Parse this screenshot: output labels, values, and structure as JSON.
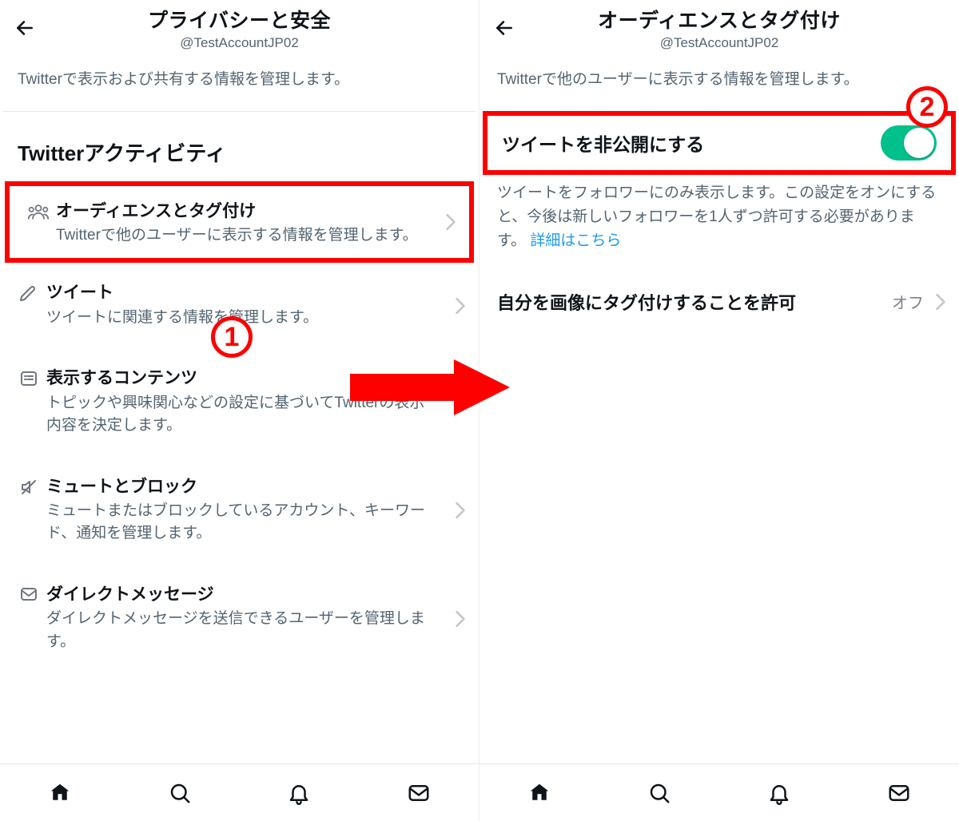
{
  "left": {
    "title": "プライバシーと安全",
    "handle": "@TestAccountJP02",
    "subhead": "Twitterで表示および共有する情報を管理します。",
    "section_label": "Twitterアクティビティ",
    "items": [
      {
        "title": "オーディエンスとタグ付け",
        "desc": "Twitterで他のユーザーに表示する情報を管理します。"
      },
      {
        "title": "ツイート",
        "desc": "ツイートに関連する情報を管理します。"
      },
      {
        "title": "表示するコンテンツ",
        "desc": "トピックや興味関心などの設定に基づいてTwitterの表示内容を決定します。"
      },
      {
        "title": "ミュートとブロック",
        "desc": "ミュートまたはブロックしているアカウント、キーワード、通知を管理します。"
      },
      {
        "title": "ダイレクトメッセージ",
        "desc": "ダイレクトメッセージを送信できるユーザーを管理します。"
      }
    ]
  },
  "right": {
    "title": "オーディエンスとタグ付け",
    "handle": "@TestAccountJP02",
    "subhead": "Twitterで他のユーザーに表示する情報を管理します。",
    "protect_label": "ツイートを非公開にする",
    "protect_desc": "ツイートをフォロワーにのみ表示します。この設定をオンにすると、今後は新しいフォロワーを1人ずつ許可する必要があります。 ",
    "learn_more": "詳細はこちら",
    "tagging_label": "自分を画像にタグ付けすることを許可",
    "tagging_value": "オフ"
  },
  "annotations": {
    "one": "1",
    "two": "2"
  },
  "colors": {
    "accent": "#ff0000",
    "toggle_on": "#00c08b",
    "link": "#1d9bf0"
  }
}
